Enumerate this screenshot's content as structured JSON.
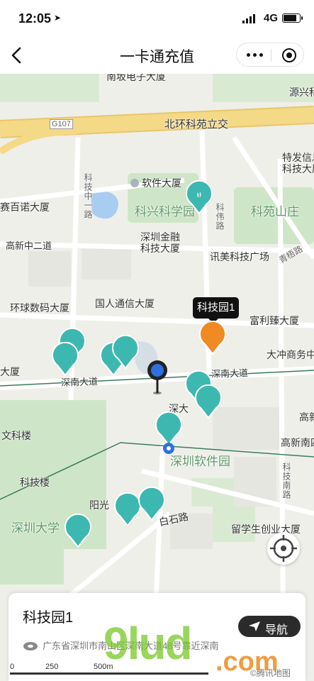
{
  "status_bar": {
    "time": "12:05",
    "network": "4G",
    "battery_level": 0.8
  },
  "nav": {
    "title": "一卡通充值"
  },
  "map": {
    "labels": [
      "南坂电子大厦",
      "源兴科",
      "北环科苑立交",
      "G107",
      "特发信息",
      "科技大厦",
      "软件大厦",
      "科技中一路",
      "赛百诺大厦",
      "科兴科学园",
      "科苑山庄",
      "科伟路",
      "高新中二道",
      "深圳金融",
      "科技大厦",
      "讯美科技广场",
      "青梧路",
      "环球数码大厦",
      "国人通信大厦",
      "富利臻大厦",
      "深南大道",
      "深南大道",
      "大冲商务中",
      "大厦",
      "深大",
      "文科楼",
      "深圳软件园",
      "高新南四",
      "科技楼",
      "阳光",
      "白石路",
      "深圳大学",
      "留学生创业大厦",
      "科技南路",
      "高新"
    ]
  },
  "callout": {
    "label": "科技园1"
  },
  "selected": {
    "name": "科技园1",
    "navigate_label": "导航",
    "address": "广东省深圳市南山区深南大道48号靠近深南"
  },
  "scale": {
    "labels": [
      "0",
      "250",
      "500m"
    ]
  },
  "attribution": "©腾讯地图",
  "watermark": {
    "text": "9lud",
    "suffix": ".com"
  },
  "colors": {
    "pin_teal": "#3db8b0",
    "pin_orange": "#f08a24",
    "road_yellow": "#f4d987",
    "park_green": "#cfe5c7"
  }
}
